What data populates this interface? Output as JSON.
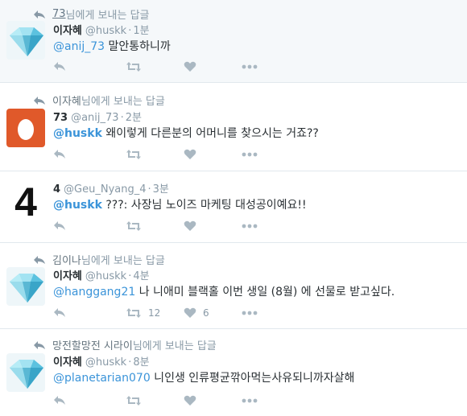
{
  "tweets": [
    {
      "context": {
        "user": "73",
        "suffix": " 님에게 보내는 답글"
      },
      "avatar": "crystal-diamond-avatar",
      "name": "이자혜",
      "handle": "@huskk",
      "dot": "·",
      "time": "1분",
      "mention": "@anij_73",
      "text": " 말안통하니까",
      "retweet_count": "",
      "like_count": ""
    },
    {
      "context": {
        "user": "이자혜",
        "suffix": " 님에게 보내는 답글"
      },
      "avatar": "egg-avatar",
      "name": "73",
      "handle": "@anij_73",
      "dot": "·",
      "time": "2분",
      "mention": "@huskk",
      "text": " 왜이렇게 다른분의 어머니를 찾으시는 거죠??",
      "retweet_count": "",
      "like_count": ""
    },
    {
      "avatar": "number-four-avatar",
      "avatar_text": "4",
      "name": "4",
      "handle": "@Geu_Nyang_4",
      "dot": "·",
      "time": "3분",
      "mention": "@huskk",
      "text": " ???: 사장님 노이즈 마케팅 대성공이예요!!",
      "retweet_count": "",
      "like_count": ""
    },
    {
      "context": {
        "user": "김이나",
        "suffix": " 님에게 보내는 답글"
      },
      "avatar": "crystal-diamond-avatar",
      "name": "이자혜",
      "handle": "@huskk",
      "dot": "·",
      "time": "4분",
      "mention": "@hanggang21",
      "text": " 나 니애미 블랙홀 이번 생일 (8월) 에 선물로 받고싶다.",
      "retweet_count": "12",
      "like_count": "6"
    },
    {
      "context": {
        "user": "망전할망전 시라이",
        "suffix": " 님에게 보내는 답글"
      },
      "avatar": "crystal-diamond-avatar",
      "name": "이자혜",
      "handle": "@huskk",
      "dot": "·",
      "time": "8분",
      "mention": "@planetarian070",
      "text": " 니인생 인류평균깎아먹는사유되니까자살해",
      "retweet_count": "",
      "like_count": ""
    }
  ],
  "colors": {
    "link": "#3b94d9",
    "muted": "#8899a6",
    "icon": "#aab8c2",
    "egg_bg": "#e0592a"
  }
}
